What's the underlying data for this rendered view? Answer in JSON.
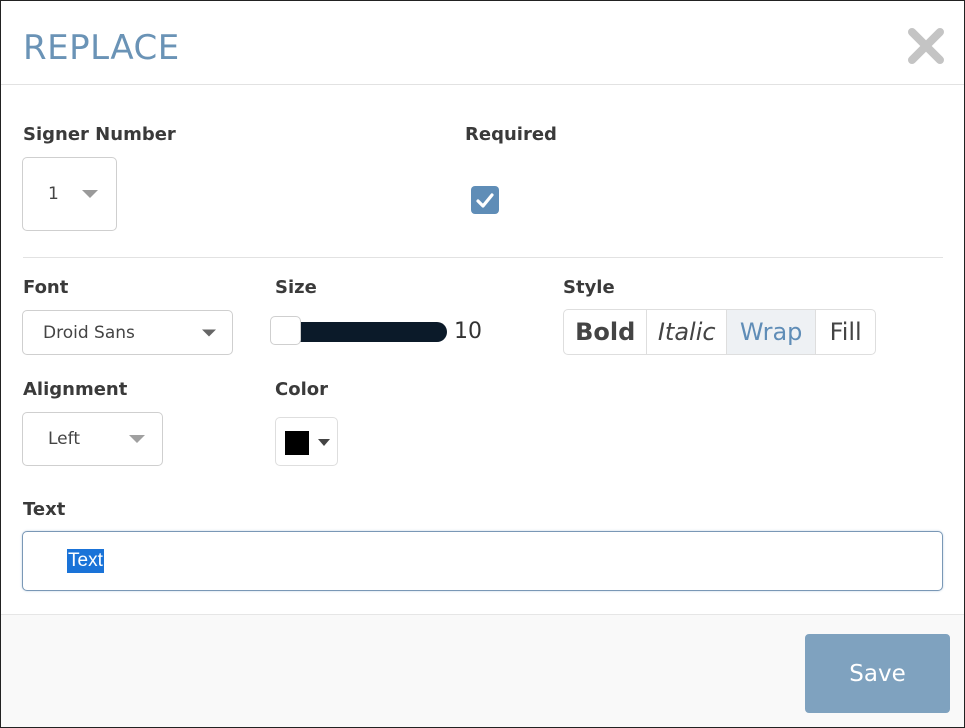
{
  "dialog": {
    "title": "REPLACE",
    "close_icon": "close-icon"
  },
  "signer": {
    "label": "Signer Number",
    "value": "1"
  },
  "required": {
    "label": "Required",
    "checked": true
  },
  "font": {
    "label": "Font",
    "value": "Droid Sans"
  },
  "size": {
    "label": "Size",
    "value": "10"
  },
  "style": {
    "label": "Style",
    "options": [
      "Bold",
      "Italic",
      "Wrap",
      "Fill"
    ],
    "active": "Wrap"
  },
  "alignment": {
    "label": "Alignment",
    "value": "Left"
  },
  "color": {
    "label": "Color",
    "value": "#000000"
  },
  "text": {
    "label": "Text",
    "value": "Text"
  },
  "footer": {
    "save_label": "Save"
  },
  "colors": {
    "accent": "#6a93b6",
    "save_button": "#7fa2bf",
    "checkbox": "#5f8db7",
    "slider_track": "#0b1a29",
    "selection": "#1a73d8"
  }
}
